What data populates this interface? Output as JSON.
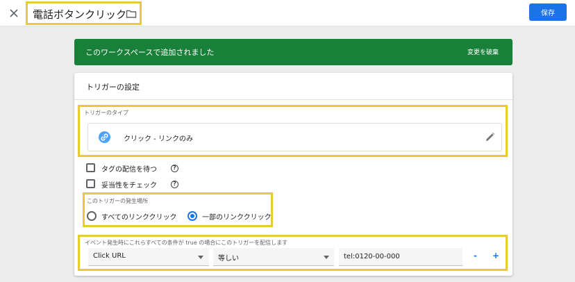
{
  "header": {
    "title": "電話ボタンクリック",
    "save_label": "保存"
  },
  "banner": {
    "message": "このワークスペースで追加されました",
    "discard_label": "変更を破棄"
  },
  "card": {
    "title": "トリガーの設定",
    "trigger_type_label": "トリガーのタイプ",
    "trigger_type_name": "クリック - リンクのみ",
    "wait_for_tags_label": "タグの配信を待つ",
    "check_validation_label": "妥当性をチェック",
    "fires_on_label": "このトリガーの発生場所",
    "radio_all_label": "すべてのリンククリック",
    "radio_some_label": "一部のリンククリック",
    "selected_option": "一部のリンククリック",
    "condition_label": "イベント発生時にこれらすべての条件が true の場合にこのトリガーを配信します",
    "condition": {
      "variable": "Click URL",
      "operator": "等しい",
      "value": "tel:0120-00-000"
    },
    "minus_label": "-",
    "plus_label": "+",
    "help_glyph": "?"
  },
  "colors": {
    "accent": "#1a73e8",
    "banner": "#188038",
    "highlight": "#e8c936"
  },
  "icons": [
    "close-icon",
    "folder-icon",
    "link-icon",
    "edit-pencil-icon",
    "help-icon",
    "dropdown-arrow-icon"
  ]
}
